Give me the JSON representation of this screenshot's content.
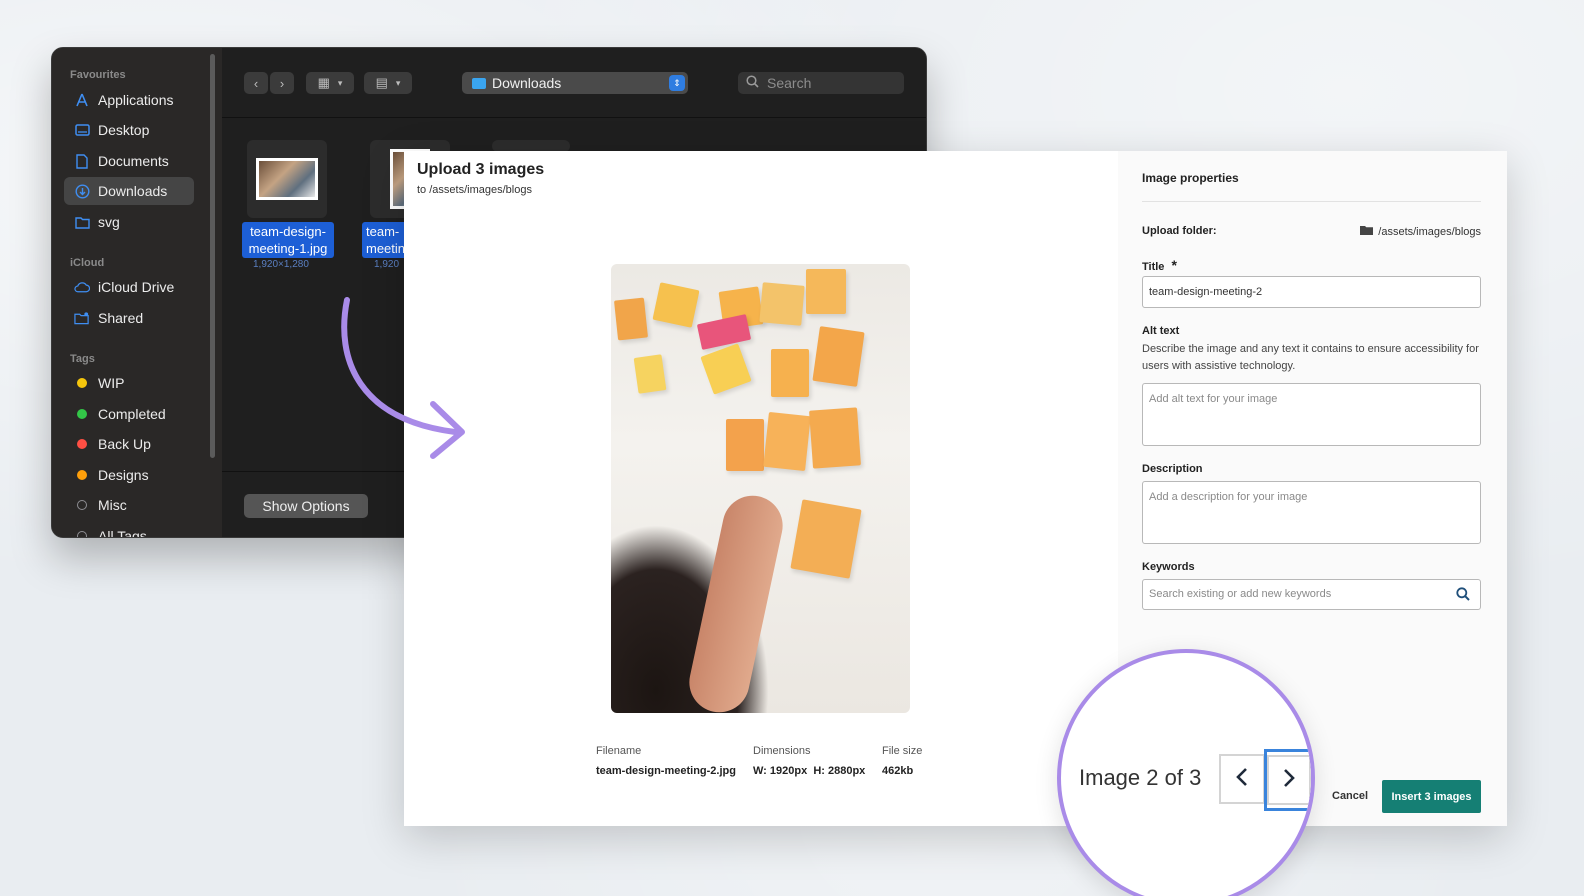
{
  "finder": {
    "sidebar": {
      "favourites_label": "Favourites",
      "favourites": [
        {
          "label": "Applications",
          "icon": "applications-icon"
        },
        {
          "label": "Desktop",
          "icon": "desktop-icon"
        },
        {
          "label": "Documents",
          "icon": "document-icon"
        },
        {
          "label": "Downloads",
          "icon": "downloads-icon",
          "active": true
        },
        {
          "label": "svg",
          "icon": "folder-icon"
        }
      ],
      "icloud_label": "iCloud",
      "icloud": [
        {
          "label": "iCloud Drive",
          "icon": "cloud-icon"
        },
        {
          "label": "Shared",
          "icon": "shared-folder-icon"
        }
      ],
      "tags_label": "Tags",
      "tags": [
        {
          "label": "WIP",
          "color": "#f5c60c"
        },
        {
          "label": "Completed",
          "color": "#33c748"
        },
        {
          "label": "Back Up",
          "color": "#ff4f44"
        },
        {
          "label": "Designs",
          "color": "#ff9f0a"
        },
        {
          "label": "Misc",
          "color": "#8e8e93"
        },
        {
          "label": "All Tags",
          "color": "#8e8e93"
        }
      ]
    },
    "toolbar": {
      "location": "Downloads",
      "search_placeholder": "Search"
    },
    "files": [
      {
        "name_line1": "team-design-",
        "name_line2": "meeting-1.jpg",
        "dims": "1,920×1,280"
      },
      {
        "name_line1": "team-",
        "name_line2": "meetin",
        "dims": "1,920"
      }
    ],
    "show_options": "Show Options"
  },
  "modal": {
    "title": "Upload 3 images",
    "subtitle": "to /assets/images/blogs",
    "meta": {
      "filename_label": "Filename",
      "filename": "team-design-meeting-2.jpg",
      "dimensions_label": "Dimensions",
      "dimensions": "W: 1920px  H: 2880px",
      "filesize_label": "File size",
      "filesize": "462kb"
    },
    "panel": {
      "heading": "Image properties",
      "upload_folder_label": "Upload folder:",
      "upload_folder": "/assets/images/blogs",
      "title_label": "Title",
      "title_value": "team-design-meeting-2",
      "alt_label": "Alt text",
      "alt_help": "Describe the image and any text it contains to ensure accessibility for users with assistive technology.",
      "alt_placeholder": "Add alt text for your image",
      "description_label": "Description",
      "description_placeholder": "Add a description for your image",
      "keywords_label": "Keywords",
      "keywords_placeholder": "Search existing or add new keywords"
    },
    "pager": {
      "counter": "Image 2 of 3"
    },
    "buttons": {
      "cancel": "Cancel",
      "insert": "Insert 3 images"
    }
  },
  "colors": {
    "accent_teal": "#157f74",
    "finder_selection": "#1d5fd6",
    "highlight_ring": "#a98be8",
    "next_focus": "#3a84dc"
  }
}
